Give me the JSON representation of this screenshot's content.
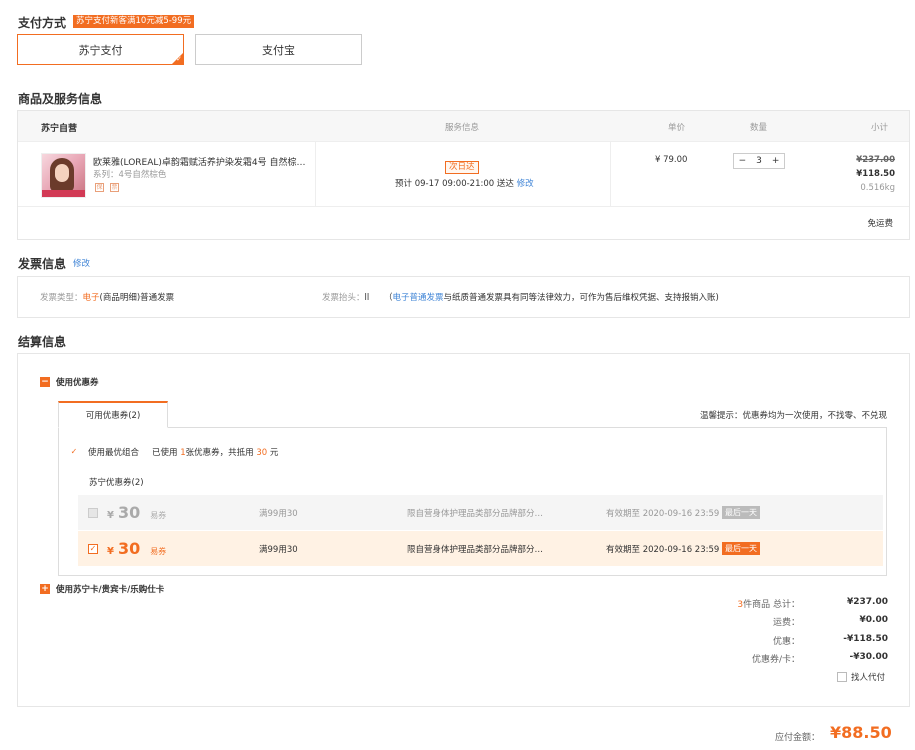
{
  "payment": {
    "title": "支付方式",
    "promo": "苏宁支付新客满10元减5-99元",
    "methods": [
      {
        "label": "苏宁支付",
        "selected": true
      },
      {
        "label": "支付宝",
        "selected": false
      }
    ]
  },
  "goods": {
    "title": "商品及服务信息",
    "headers": {
      "seller": "苏宁自营",
      "service": "服务信息",
      "price": "单价",
      "qty": "数量",
      "subtotal": "小计"
    },
    "item": {
      "name": "欧莱雅(LOREAL)卓韵霜赋活养护染发霜4号 自然棕…",
      "spec": "系列：4号自然棕色",
      "delivery_tag": "次日达",
      "delivery_prefix": "预计",
      "delivery_time": "09-17 09:00-21:00",
      "delivery_suffix": "送达",
      "modify": "修改",
      "price": "¥ 79.00",
      "qty_minus": "−",
      "qty": "3",
      "qty_plus": "+",
      "original_total": "¥237.00",
      "total": "¥118.50",
      "weight": "0.516kg"
    },
    "shipping_note": "免运费"
  },
  "invoice": {
    "title": "发票信息",
    "modify": "修改",
    "type_label": "发票类型：",
    "type_value_highlight": "电子",
    "type_value": "(商品明细)普通发票",
    "header_label": "发票抬头：",
    "header_value": "ll",
    "note_open": "（",
    "note_link": "电子普通发票",
    "note_rest": "与纸质普通发票具有同等法律效力，可作为售后维权凭据、支持报销入账)"
  },
  "settlement": {
    "title": "结算信息",
    "coupon_toggle": "使用优惠券",
    "tab_label": "可用优惠券(2)",
    "tip": "温馨提示：优惠券均为一次使用，不找零、不兑现",
    "best_combo_label": "使用最优组合",
    "best_combo_pre": "已使用",
    "best_combo_count": "1",
    "best_combo_mid": "张优惠券，共抵用",
    "best_combo_amount": "30",
    "best_combo_unit": "元",
    "group_label": "苏宁优惠券(2)",
    "coupons": [
      {
        "yen": "¥",
        "amount": "30",
        "type": "易券",
        "condition": "满99用30",
        "scope": "限自营身体护理品类部分品牌部分…",
        "expiry": "有效期至 2020-09-16 23:59",
        "badge": "最后一天",
        "checked": false
      },
      {
        "yen": "¥",
        "amount": "30",
        "type": "易券",
        "condition": "满99用30",
        "scope": "限自营身体护理品类部分品牌部分…",
        "expiry": "有效期至 2020-09-16 23:59",
        "badge": "最后一天",
        "checked": true
      }
    ],
    "card_toggle": "使用苏宁卡/贵宾卡/乐购仕卡"
  },
  "totals": {
    "count": "3",
    "items_label": "件商品 总计：",
    "items_total": "¥237.00",
    "shipping_label": "运费：",
    "shipping": "¥0.00",
    "discount_label": "优惠：",
    "discount": "-¥118.50",
    "coupon_label": "优惠券/卡：",
    "coupon": "-¥30.00",
    "proxy_pay": "找人代付",
    "payable_label": "应付金额：",
    "payable": "¥88.50"
  },
  "colors": {
    "accent": "#f26d21",
    "link": "#3f84d6",
    "last_day_gray": "#bbbbbb"
  }
}
